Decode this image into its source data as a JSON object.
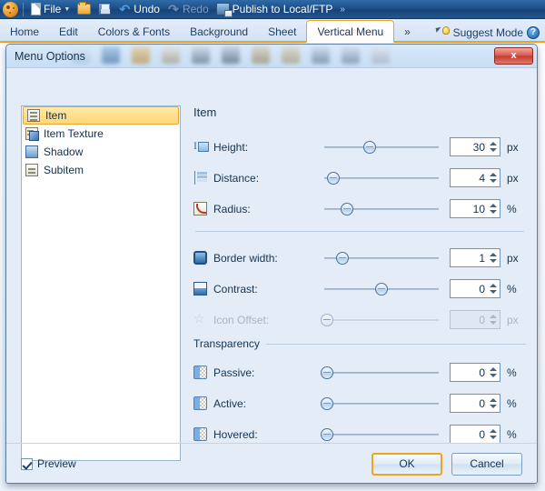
{
  "quick_access": {
    "logo_icon": "palette-icon",
    "items": [
      {
        "label": "File",
        "icon": "document-icon",
        "has_caret": true,
        "disabled": false
      },
      {
        "label": "",
        "icon": "open-folder-icon",
        "has_caret": false,
        "disabled": false
      },
      {
        "label": "",
        "icon": "save-icon",
        "has_caret": false,
        "disabled": false
      },
      {
        "label": "Undo",
        "icon": "undo-icon",
        "has_caret": false,
        "disabled": false
      },
      {
        "label": "Redo",
        "icon": "redo-icon",
        "has_caret": false,
        "disabled": true
      },
      {
        "label": "Publish to Local/FTP",
        "icon": "publish-icon",
        "has_caret": false,
        "disabled": false
      }
    ],
    "more_label": "»"
  },
  "ribbon": {
    "tabs": [
      {
        "label": "Home",
        "active": false
      },
      {
        "label": "Edit",
        "active": false
      },
      {
        "label": "Colors & Fonts",
        "active": false
      },
      {
        "label": "Background",
        "active": false
      },
      {
        "label": "Sheet",
        "active": false
      },
      {
        "label": "Vertical Menu",
        "active": true
      },
      {
        "label": "»",
        "active": false
      }
    ],
    "suggest_mode_label": "Suggest Mode",
    "help_label": "?"
  },
  "dialog": {
    "title": "Menu Options",
    "close_label": "x",
    "list": {
      "items": [
        {
          "label": "Item",
          "icon": "item-icon",
          "selected": true
        },
        {
          "label": "Item Texture",
          "icon": "item-texture-icon",
          "selected": false
        },
        {
          "label": "Shadow",
          "icon": "shadow-icon",
          "selected": false
        },
        {
          "label": "Subitem",
          "icon": "subitem-icon",
          "selected": false
        }
      ]
    },
    "panel": {
      "title": "Item",
      "rows_group1": [
        {
          "label": "Height:",
          "icon": "height-icon",
          "value": "30",
          "unit": "px",
          "slider_pct": 40,
          "disabled": false
        },
        {
          "label": "Distance:",
          "icon": "distance-icon",
          "value": "4",
          "unit": "px",
          "slider_pct": 8,
          "disabled": false
        },
        {
          "label": "Radius:",
          "icon": "radius-icon",
          "value": "10",
          "unit": "%",
          "slider_pct": 20,
          "disabled": false
        }
      ],
      "rows_group2": [
        {
          "label": "Border width:",
          "icon": "border-width-icon",
          "value": "1",
          "unit": "px",
          "slider_pct": 16,
          "disabled": false
        },
        {
          "label": "Contrast:",
          "icon": "contrast-icon",
          "value": "0",
          "unit": "%",
          "slider_pct": 50,
          "disabled": false
        },
        {
          "label": "Icon Offset:",
          "icon": "icon-offset-icon",
          "value": "0",
          "unit": "px",
          "slider_pct": 2,
          "disabled": true
        }
      ],
      "transparency_group_label": "Transparency",
      "rows_group3": [
        {
          "label": "Passive:",
          "icon": "transparency-icon",
          "value": "0",
          "unit": "%",
          "slider_pct": 2,
          "disabled": false
        },
        {
          "label": "Active:",
          "icon": "transparency-icon",
          "value": "0",
          "unit": "%",
          "slider_pct": 2,
          "disabled": false
        },
        {
          "label": "Hovered:",
          "icon": "transparency-icon",
          "value": "0",
          "unit": "%",
          "slider_pct": 2,
          "disabled": false
        }
      ]
    },
    "footer": {
      "preview_label": "Preview",
      "preview_checked": true,
      "ok_label": "OK",
      "cancel_label": "Cancel"
    }
  },
  "colors": {
    "accent_orange": "#f0a323",
    "titlebar_blue": "#1d4f87",
    "dialog_bg": "#e3ecf7",
    "selection": "#ffd776",
    "close_red": "#c23c30"
  }
}
